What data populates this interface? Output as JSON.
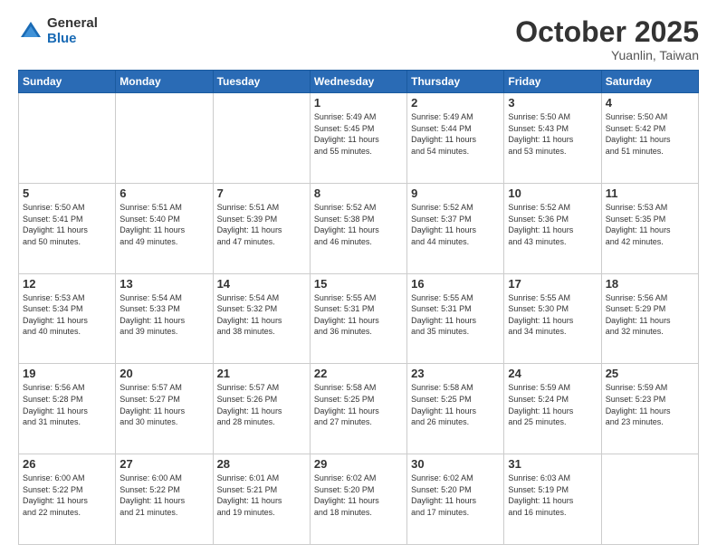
{
  "logo": {
    "general": "General",
    "blue": "Blue"
  },
  "header": {
    "title": "October 2025",
    "subtitle": "Yuanlin, Taiwan"
  },
  "weekdays": [
    "Sunday",
    "Monday",
    "Tuesday",
    "Wednesday",
    "Thursday",
    "Friday",
    "Saturday"
  ],
  "weeks": [
    [
      {
        "day": "",
        "info": "",
        "empty": true
      },
      {
        "day": "",
        "info": "",
        "empty": true
      },
      {
        "day": "",
        "info": "",
        "empty": true
      },
      {
        "day": "1",
        "info": "Sunrise: 5:49 AM\nSunset: 5:45 PM\nDaylight: 11 hours\nand 55 minutes."
      },
      {
        "day": "2",
        "info": "Sunrise: 5:49 AM\nSunset: 5:44 PM\nDaylight: 11 hours\nand 54 minutes."
      },
      {
        "day": "3",
        "info": "Sunrise: 5:50 AM\nSunset: 5:43 PM\nDaylight: 11 hours\nand 53 minutes."
      },
      {
        "day": "4",
        "info": "Sunrise: 5:50 AM\nSunset: 5:42 PM\nDaylight: 11 hours\nand 51 minutes."
      }
    ],
    [
      {
        "day": "5",
        "info": "Sunrise: 5:50 AM\nSunset: 5:41 PM\nDaylight: 11 hours\nand 50 minutes."
      },
      {
        "day": "6",
        "info": "Sunrise: 5:51 AM\nSunset: 5:40 PM\nDaylight: 11 hours\nand 49 minutes."
      },
      {
        "day": "7",
        "info": "Sunrise: 5:51 AM\nSunset: 5:39 PM\nDaylight: 11 hours\nand 47 minutes."
      },
      {
        "day": "8",
        "info": "Sunrise: 5:52 AM\nSunset: 5:38 PM\nDaylight: 11 hours\nand 46 minutes."
      },
      {
        "day": "9",
        "info": "Sunrise: 5:52 AM\nSunset: 5:37 PM\nDaylight: 11 hours\nand 44 minutes."
      },
      {
        "day": "10",
        "info": "Sunrise: 5:52 AM\nSunset: 5:36 PM\nDaylight: 11 hours\nand 43 minutes."
      },
      {
        "day": "11",
        "info": "Sunrise: 5:53 AM\nSunset: 5:35 PM\nDaylight: 11 hours\nand 42 minutes."
      }
    ],
    [
      {
        "day": "12",
        "info": "Sunrise: 5:53 AM\nSunset: 5:34 PM\nDaylight: 11 hours\nand 40 minutes."
      },
      {
        "day": "13",
        "info": "Sunrise: 5:54 AM\nSunset: 5:33 PM\nDaylight: 11 hours\nand 39 minutes."
      },
      {
        "day": "14",
        "info": "Sunrise: 5:54 AM\nSunset: 5:32 PM\nDaylight: 11 hours\nand 38 minutes."
      },
      {
        "day": "15",
        "info": "Sunrise: 5:55 AM\nSunset: 5:31 PM\nDaylight: 11 hours\nand 36 minutes."
      },
      {
        "day": "16",
        "info": "Sunrise: 5:55 AM\nSunset: 5:31 PM\nDaylight: 11 hours\nand 35 minutes."
      },
      {
        "day": "17",
        "info": "Sunrise: 5:55 AM\nSunset: 5:30 PM\nDaylight: 11 hours\nand 34 minutes."
      },
      {
        "day": "18",
        "info": "Sunrise: 5:56 AM\nSunset: 5:29 PM\nDaylight: 11 hours\nand 32 minutes."
      }
    ],
    [
      {
        "day": "19",
        "info": "Sunrise: 5:56 AM\nSunset: 5:28 PM\nDaylight: 11 hours\nand 31 minutes."
      },
      {
        "day": "20",
        "info": "Sunrise: 5:57 AM\nSunset: 5:27 PM\nDaylight: 11 hours\nand 30 minutes."
      },
      {
        "day": "21",
        "info": "Sunrise: 5:57 AM\nSunset: 5:26 PM\nDaylight: 11 hours\nand 28 minutes."
      },
      {
        "day": "22",
        "info": "Sunrise: 5:58 AM\nSunset: 5:25 PM\nDaylight: 11 hours\nand 27 minutes."
      },
      {
        "day": "23",
        "info": "Sunrise: 5:58 AM\nSunset: 5:25 PM\nDaylight: 11 hours\nand 26 minutes."
      },
      {
        "day": "24",
        "info": "Sunrise: 5:59 AM\nSunset: 5:24 PM\nDaylight: 11 hours\nand 25 minutes."
      },
      {
        "day": "25",
        "info": "Sunrise: 5:59 AM\nSunset: 5:23 PM\nDaylight: 11 hours\nand 23 minutes."
      }
    ],
    [
      {
        "day": "26",
        "info": "Sunrise: 6:00 AM\nSunset: 5:22 PM\nDaylight: 11 hours\nand 22 minutes."
      },
      {
        "day": "27",
        "info": "Sunrise: 6:00 AM\nSunset: 5:22 PM\nDaylight: 11 hours\nand 21 minutes."
      },
      {
        "day": "28",
        "info": "Sunrise: 6:01 AM\nSunset: 5:21 PM\nDaylight: 11 hours\nand 19 minutes."
      },
      {
        "day": "29",
        "info": "Sunrise: 6:02 AM\nSunset: 5:20 PM\nDaylight: 11 hours\nand 18 minutes."
      },
      {
        "day": "30",
        "info": "Sunrise: 6:02 AM\nSunset: 5:20 PM\nDaylight: 11 hours\nand 17 minutes."
      },
      {
        "day": "31",
        "info": "Sunrise: 6:03 AM\nSunset: 5:19 PM\nDaylight: 11 hours\nand 16 minutes."
      },
      {
        "day": "",
        "info": "",
        "empty": true
      }
    ]
  ]
}
